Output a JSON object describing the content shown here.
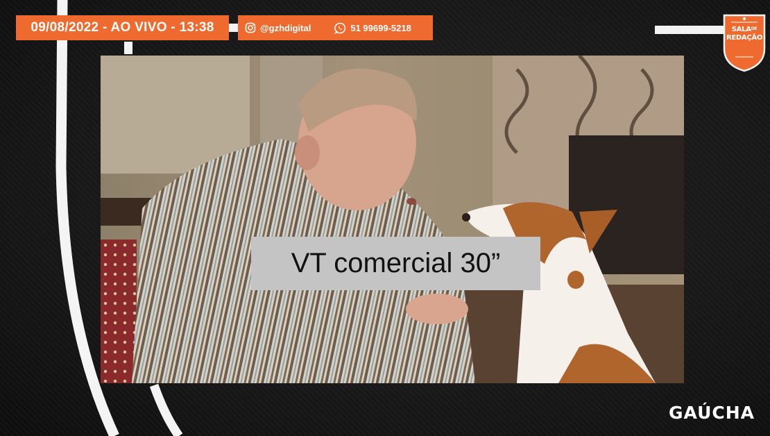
{
  "banner": {
    "date_live": "09/08/2022 - AO VIVO - 13:38",
    "instagram": "@gzhdigital",
    "whatsapp": "51 99699-5218"
  },
  "badge": {
    "line1": "SALA",
    "line1_small": "DE",
    "line2": "REDAÇÃO"
  },
  "caption": "VT comercial 30”",
  "brand": "GAÚCHA",
  "colors": {
    "accent": "#ef6a2e",
    "background": "#161616",
    "caption_box": "#c4c4c4"
  },
  "icons": [
    "instagram-icon",
    "whatsapp-icon"
  ]
}
